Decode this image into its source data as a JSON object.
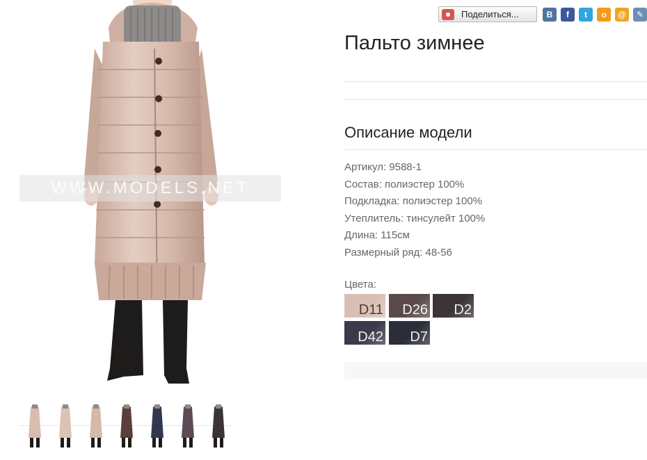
{
  "share": {
    "button_label": "Поделиться...",
    "icons": [
      {
        "name": "vkontakte",
        "glyph": "B",
        "color": "#4c75a3"
      },
      {
        "name": "facebook",
        "glyph": "f",
        "color": "#3b5998"
      },
      {
        "name": "twitter",
        "glyph": "t",
        "color": "#2fa6e0"
      },
      {
        "name": "odnoklassniki",
        "glyph": "o",
        "color": "#f59a1b"
      },
      {
        "name": "mail-ru",
        "glyph": "@",
        "color": "#f0a623"
      },
      {
        "name": "livejournal",
        "glyph": "✎",
        "color": "#6d8fb3"
      }
    ]
  },
  "photo": {
    "watermark": "WWW.MODELS.NET"
  },
  "product": {
    "title": "Пальто зимнее",
    "description_heading": "Описание модели",
    "specs": [
      "Артикул: 9588-1",
      "Состав: полиэстер 100%",
      "Подкладка: полиэстер 100%",
      "Утеплитель: тинсулейт 100%",
      "Длина: 115см",
      "Размерный ряд: 48-56"
    ],
    "colors_label": "Цвета:",
    "colors": [
      {
        "code": "D11",
        "color": "#d9bfb3"
      },
      {
        "code": "D26",
        "color": "#5a4a4c"
      },
      {
        "code": "D2",
        "color": "#3c3436"
      },
      {
        "code": "D42",
        "color": "#3b3a4a"
      },
      {
        "code": "D7",
        "color": "#2b2e38"
      }
    ]
  },
  "thumbnails": [
    {
      "label": "coat-beige-1",
      "color": "#d8bcae"
    },
    {
      "label": "coat-beige-2",
      "color": "#dcc2b4"
    },
    {
      "label": "coat-beige-3",
      "color": "#d6b9a9"
    },
    {
      "label": "coat-brown",
      "color": "#5a3f3a"
    },
    {
      "label": "coat-navy",
      "color": "#2f3850"
    },
    {
      "label": "coat-mauve",
      "color": "#5e4b55"
    },
    {
      "label": "coat-dark",
      "color": "#3a3438"
    }
  ]
}
